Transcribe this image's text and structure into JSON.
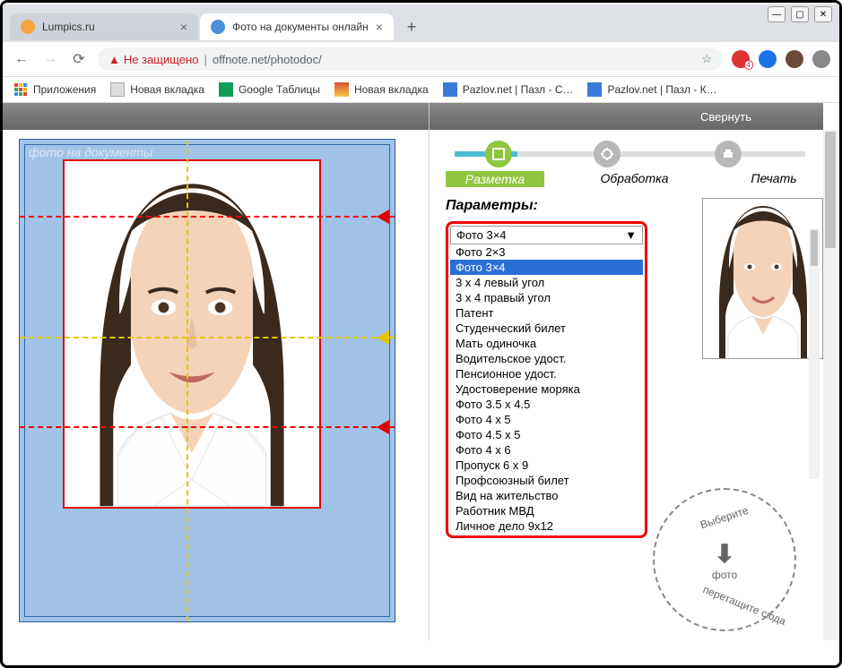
{
  "window": {
    "minimize": "—",
    "maximize": "▢",
    "close": "✕"
  },
  "tabs": [
    {
      "title": "Lumpics.ru",
      "favicon_color": "#f7a440"
    },
    {
      "title": "Фото на документы онлайн",
      "favicon_color": "#4a90d9"
    }
  ],
  "new_tab": "+",
  "nav": {
    "back": "←",
    "forward": "→",
    "reload": "⟳"
  },
  "url": {
    "warning": "Не защищено",
    "host_path": "offnote.net/photodoc/",
    "star": "☆"
  },
  "extensions": {
    "badge": "4"
  },
  "bookmarks": [
    {
      "label": "Приложения",
      "color": "#4285f4"
    },
    {
      "label": "Новая вкладка",
      "color": "#888"
    },
    {
      "label": "Google Таблицы",
      "color": "#0f9d58"
    },
    {
      "label": "Новая вкладка",
      "color": "#d94f3a"
    },
    {
      "label": "Pazlov.net | Пазл - С…",
      "color": "#3a79d9"
    },
    {
      "label": "Pazlov.net | Пазл - К…",
      "color": "#3a79d9"
    }
  ],
  "grey_header": {
    "collapse": "Свернуть"
  },
  "watermark": "фото на документы",
  "steps": {
    "items": [
      {
        "label": "Разметка",
        "active": true
      },
      {
        "label": "Обработка",
        "active": false
      },
      {
        "label": "Печать",
        "active": false
      }
    ]
  },
  "params": {
    "title": "Параметры:",
    "selected": "Фото 3×4",
    "options": [
      "Фото 2×3",
      "Фото 3×4",
      "3 x 4 левый угол",
      "3 x 4 правый угол",
      "Патент",
      "Студенческий билет",
      "Мать одиночка",
      "Водительское удост.",
      "Пенсионное удост.",
      "Удостоверение моряка",
      "Фото 3.5 x 4.5",
      "Фото 4 x 5",
      "Фото 4.5 x 5",
      "Фото 4 x 6",
      "Пропуск 6 x 9",
      "Профсоюзный билет",
      "Вид на жительство",
      "Работник МВД",
      "Личное дело 9x12"
    ]
  },
  "drop": {
    "text_top": "Выберите",
    "text_bottom": "перетащите сюда",
    "label": "фото"
  }
}
